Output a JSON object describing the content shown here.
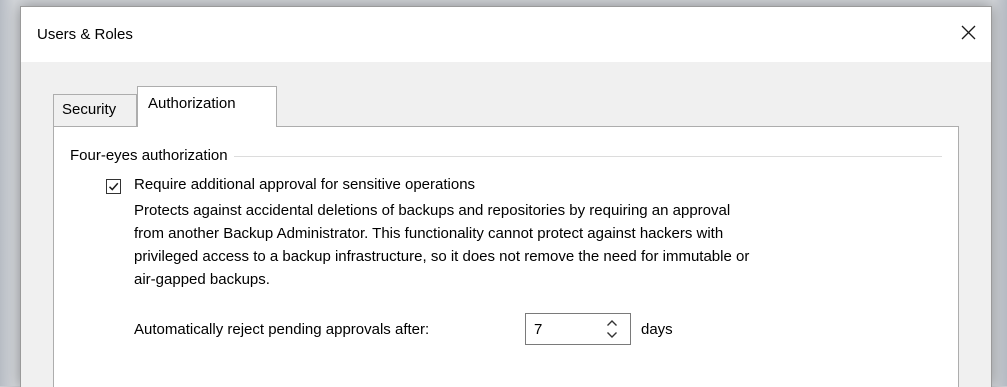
{
  "window": {
    "title": "Users & Roles",
    "close_icon": "close-icon"
  },
  "tabs": [
    {
      "label": "Security",
      "selected": false
    },
    {
      "label": "Authorization",
      "selected": true
    }
  ],
  "four_eyes": {
    "group_title": "Four-eyes authorization",
    "require_approval": {
      "checked": true,
      "label": "Require additional approval for sensitive operations"
    },
    "description_lines": [
      "Protects against accidental deletions of backups and repositories by requiring an approval",
      "from another Backup Administrator. This functionality cannot protect against hackers with",
      "privileged access to a backup infrastructure, so it does not remove the need for immutable or",
      "air-gapped backups."
    ],
    "auto_reject": {
      "label": "Automatically reject pending approvals after:",
      "value": "7",
      "unit": "days"
    }
  },
  "colors": {
    "titlebar": "#ffffff",
    "dialog_bg": "#f0f0f0",
    "panel_bg": "#ffffff",
    "border": "#adadad"
  }
}
